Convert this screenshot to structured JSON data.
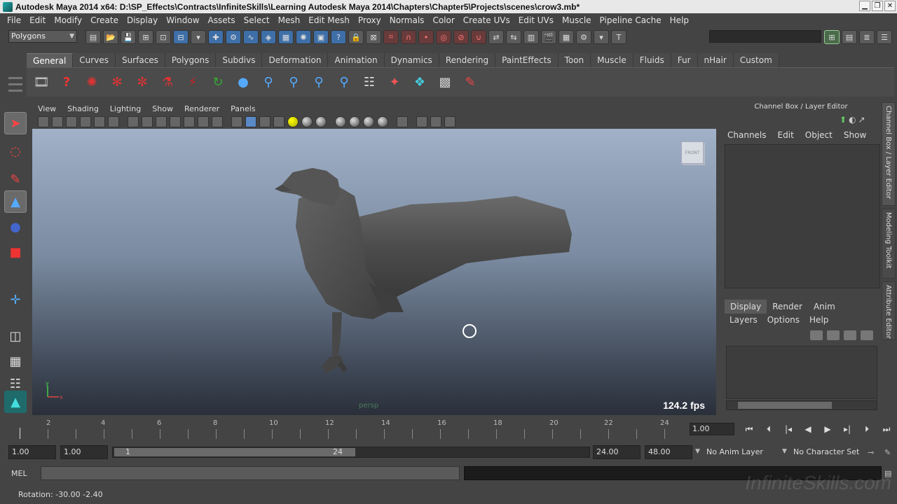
{
  "window": {
    "title": "Autodesk Maya 2014 x64: D:\\SP_Effects\\Contracts\\InfiniteSkills\\Learning Autodesk Maya 2014\\Chapters\\Chapter5\\Projects\\scenes\\crow3.mb*",
    "minimize": "▁",
    "restore": "❐",
    "close": "✕"
  },
  "menubar": [
    "File",
    "Edit",
    "Modify",
    "Create",
    "Display",
    "Window",
    "Assets",
    "Select",
    "Mesh",
    "Edit Mesh",
    "Proxy",
    "Normals",
    "Color",
    "Create UVs",
    "Edit UVs",
    "Muscle",
    "Pipeline Cache",
    "Help"
  ],
  "statusline": {
    "mode": "Polygons"
  },
  "shelf": {
    "tabs": [
      "General",
      "Curves",
      "Surfaces",
      "Polygons",
      "Subdivs",
      "Deformation",
      "Animation",
      "Dynamics",
      "Rendering",
      "PaintEffects",
      "Toon",
      "Muscle",
      "Fluids",
      "Fur",
      "nHair",
      "Custom"
    ],
    "active_tab": "General"
  },
  "viewport": {
    "menu": [
      "View",
      "Shading",
      "Lighting",
      "Show",
      "Renderer",
      "Panels"
    ],
    "fps": "124.2 fps",
    "camera": "persp",
    "viewcube": "FRONT"
  },
  "channel_box": {
    "title": "Channel Box / Layer Editor",
    "menu": [
      "Channels",
      "Edit",
      "Object",
      "Show"
    ],
    "layer_tabs": [
      "Display",
      "Render",
      "Anim"
    ],
    "active_layer_tab": "Display",
    "layer_menu": [
      "Layers",
      "Options",
      "Help"
    ]
  },
  "side_tabs": [
    "Channel Box / Layer Editor",
    "Modeling Toolkit",
    "Attribute Editor"
  ],
  "timeline": {
    "ticks": [
      "2",
      "4",
      "6",
      "8",
      "10",
      "12",
      "14",
      "16",
      "18",
      "20",
      "22",
      "24"
    ],
    "current_time": "1.00"
  },
  "range": {
    "start": "1.00",
    "playback_start": "1.00",
    "range_start_label": "1",
    "range_end_label": "24",
    "playback_end": "24.00",
    "end": "48.00",
    "anim_layer": "No Anim Layer",
    "character_set": "No Character Set"
  },
  "command": {
    "label": "MEL"
  },
  "helpline": {
    "text": "Rotation:  -30.00     -2.40"
  },
  "watermark": "InfiniteSkills.com",
  "colors": {
    "ui_bg": "#444444",
    "viewport_top": "#a0b1c8",
    "viewport_bottom": "#2a303a"
  }
}
